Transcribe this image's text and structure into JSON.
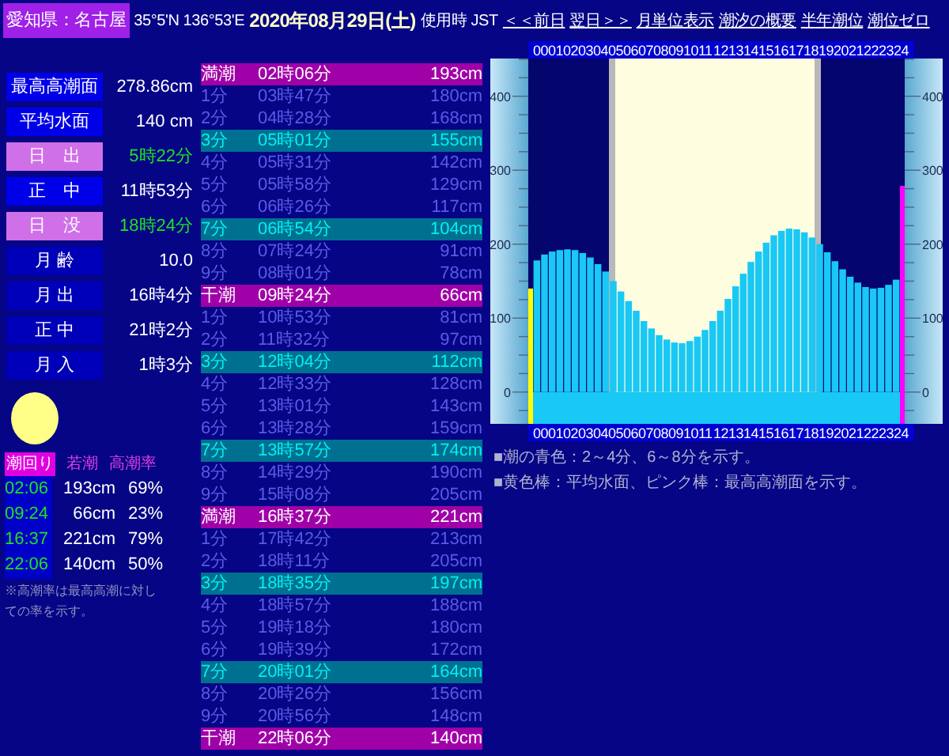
{
  "header": {
    "location": "愛知県：名古屋",
    "coords": "35°5'N 136°53'E",
    "date": "2020年08月29日(土)",
    "timezone": "使用時 JST",
    "links": [
      "＜＜前日",
      "翌日＞＞",
      "月単位表示",
      "潮汐の概要",
      "半年潮位",
      "潮位ゼロ"
    ]
  },
  "info": [
    {
      "label": "最高高潮面",
      "value": "278.86cm",
      "kind": "normal"
    },
    {
      "label": "平均水面",
      "value": "140 cm",
      "kind": "normal"
    },
    {
      "label": "日　出",
      "value": "5時22分",
      "kind": "sun"
    },
    {
      "label": "正　中",
      "value": "11時53分",
      "kind": "normal"
    },
    {
      "label": "日　没",
      "value": "18時24分",
      "kind": "sun"
    },
    {
      "label": "月 齢",
      "value": "10.0",
      "kind": "normal"
    },
    {
      "label": "月 出",
      "value": "16時4分",
      "kind": "normal"
    },
    {
      "label": "正 中",
      "value": "21時2分",
      "kind": "normal"
    },
    {
      "label": "月 入",
      "value": "1時3分",
      "kind": "normal"
    }
  ],
  "tide_cycle": {
    "label": "潮回り",
    "name": "若潮",
    "rate_label": "高潮率",
    "rows": [
      {
        "time": "02:06",
        "height": "193cm",
        "rate": "69%"
      },
      {
        "time": "09:24",
        "height": "66cm",
        "rate": "23%"
      },
      {
        "time": "16:37",
        "height": "221cm",
        "rate": "79%"
      },
      {
        "time": "22:06",
        "height": "140cm",
        "rate": "50%"
      }
    ],
    "note": "※高潮率は最高高潮に対しての率を示す。"
  },
  "table": {
    "rows": [
      {
        "label": "満潮",
        "time": "02時06分",
        "height": "193cm",
        "kind": "extreme"
      },
      {
        "label": "1分",
        "time": "03時47分",
        "height": "180cm",
        "kind": "normal"
      },
      {
        "label": "2分",
        "time": "04時28分",
        "height": "168cm",
        "kind": "normal"
      },
      {
        "label": "3分",
        "time": "05時01分",
        "height": "155cm",
        "kind": "marker"
      },
      {
        "label": "4分",
        "time": "05時31分",
        "height": "142cm",
        "kind": "normal"
      },
      {
        "label": "5分",
        "time": "05時58分",
        "height": "129cm",
        "kind": "normal"
      },
      {
        "label": "6分",
        "time": "06時26分",
        "height": "117cm",
        "kind": "normal"
      },
      {
        "label": "7分",
        "time": "06時54分",
        "height": "104cm",
        "kind": "marker"
      },
      {
        "label": "8分",
        "time": "07時24分",
        "height": "91cm",
        "kind": "normal"
      },
      {
        "label": "9分",
        "time": "08時01分",
        "height": "78cm",
        "kind": "normal"
      },
      {
        "label": "干潮",
        "time": "09時24分",
        "height": "66cm",
        "kind": "extreme"
      },
      {
        "label": "1分",
        "time": "10時53分",
        "height": "81cm",
        "kind": "normal"
      },
      {
        "label": "2分",
        "time": "11時32分",
        "height": "97cm",
        "kind": "normal"
      },
      {
        "label": "3分",
        "time": "12時04分",
        "height": "112cm",
        "kind": "marker"
      },
      {
        "label": "4分",
        "time": "12時33分",
        "height": "128cm",
        "kind": "normal"
      },
      {
        "label": "5分",
        "time": "13時01分",
        "height": "143cm",
        "kind": "normal"
      },
      {
        "label": "6分",
        "time": "13時28分",
        "height": "159cm",
        "kind": "normal"
      },
      {
        "label": "7分",
        "time": "13時57分",
        "height": "174cm",
        "kind": "marker"
      },
      {
        "label": "8分",
        "time": "14時29分",
        "height": "190cm",
        "kind": "normal"
      },
      {
        "label": "9分",
        "time": "15時08分",
        "height": "205cm",
        "kind": "normal"
      },
      {
        "label": "満潮",
        "time": "16時37分",
        "height": "221cm",
        "kind": "extreme"
      },
      {
        "label": "1分",
        "time": "17時42分",
        "height": "213cm",
        "kind": "normal"
      },
      {
        "label": "2分",
        "time": "18時11分",
        "height": "205cm",
        "kind": "normal"
      },
      {
        "label": "3分",
        "time": "18時35分",
        "height": "197cm",
        "kind": "marker"
      },
      {
        "label": "4分",
        "time": "18時57分",
        "height": "188cm",
        "kind": "normal"
      },
      {
        "label": "5分",
        "time": "19時18分",
        "height": "180cm",
        "kind": "normal"
      },
      {
        "label": "6分",
        "time": "19時39分",
        "height": "172cm",
        "kind": "normal"
      },
      {
        "label": "7分",
        "time": "20時01分",
        "height": "164cm",
        "kind": "marker"
      },
      {
        "label": "8分",
        "time": "20時26分",
        "height": "156cm",
        "kind": "normal"
      },
      {
        "label": "9分",
        "time": "20時56分",
        "height": "148cm",
        "kind": "normal"
      },
      {
        "label": "干潮",
        "time": "22時06分",
        "height": "140cm",
        "kind": "extreme"
      }
    ]
  },
  "chart": {
    "chart_data": {
      "type": "bar",
      "xticks": [
        {
          "value": 0,
          "label": "00"
        },
        {
          "value": 1,
          "label": "01"
        },
        {
          "value": 2,
          "label": "02"
        },
        {
          "value": 3,
          "label": "03"
        },
        {
          "value": 4,
          "label": "04"
        },
        {
          "value": 5,
          "label": "05"
        },
        {
          "value": 6,
          "label": "06"
        },
        {
          "value": 7,
          "label": "07"
        },
        {
          "value": 8,
          "label": "08"
        },
        {
          "value": 9,
          "label": "09"
        },
        {
          "value": 10,
          "label": "10"
        },
        {
          "value": 11,
          "label": "11"
        },
        {
          "value": 12,
          "label": "12"
        },
        {
          "value": 13,
          "label": "13"
        },
        {
          "value": 14,
          "label": "14"
        },
        {
          "value": 15,
          "label": "15"
        },
        {
          "value": 16,
          "label": "16"
        },
        {
          "value": 17,
          "label": "17"
        },
        {
          "value": 18,
          "label": "18"
        },
        {
          "value": 19,
          "label": "19"
        },
        {
          "value": 20,
          "label": "20"
        },
        {
          "value": 21,
          "label": "21"
        },
        {
          "value": 22,
          "label": "22"
        },
        {
          "value": 23,
          "label": "23"
        },
        {
          "value": 24,
          "label": "24"
        }
      ],
      "x": [
        0,
        0.5,
        1,
        1.5,
        2,
        2.5,
        3,
        3.5,
        4,
        4.5,
        5,
        5.5,
        6,
        6.5,
        7,
        7.5,
        8,
        8.5,
        9,
        9.5,
        10,
        10.5,
        11,
        11.5,
        12,
        12.5,
        13,
        13.5,
        14,
        14.5,
        15,
        15.5,
        16,
        16.5,
        17,
        17.5,
        18,
        18.5,
        19,
        19.5,
        20,
        20.5,
        21,
        21.5,
        22,
        22.5,
        23,
        23.5
      ],
      "series": [
        {
          "color": "#19c8f5",
          "values": [
            178,
            186,
            190,
            192,
            193,
            192,
            188,
            182,
            173,
            163,
            150,
            136,
            123,
            110,
            96,
            86,
            77,
            71,
            67,
            66,
            69,
            75,
            84,
            96,
            110,
            126,
            143,
            160,
            176,
            190,
            202,
            212,
            218,
            221,
            220,
            216,
            209,
            200,
            189,
            177,
            166,
            156,
            148,
            142,
            140,
            141,
            145,
            152
          ]
        }
      ],
      "xlim": [
        0,
        24
      ],
      "ylim": [
        -43,
        451
      ],
      "yticks": [
        0,
        100,
        200,
        300,
        400
      ]
    },
    "left_scale_labels": [
      "400",
      "300",
      "200",
      "100",
      "0"
    ]
  },
  "notes": [
    "■潮の青色：2～4分、6～8分を示す。",
    "■黄色棒：平均水面、ピンク棒：最高高潮面を示す。"
  ]
}
